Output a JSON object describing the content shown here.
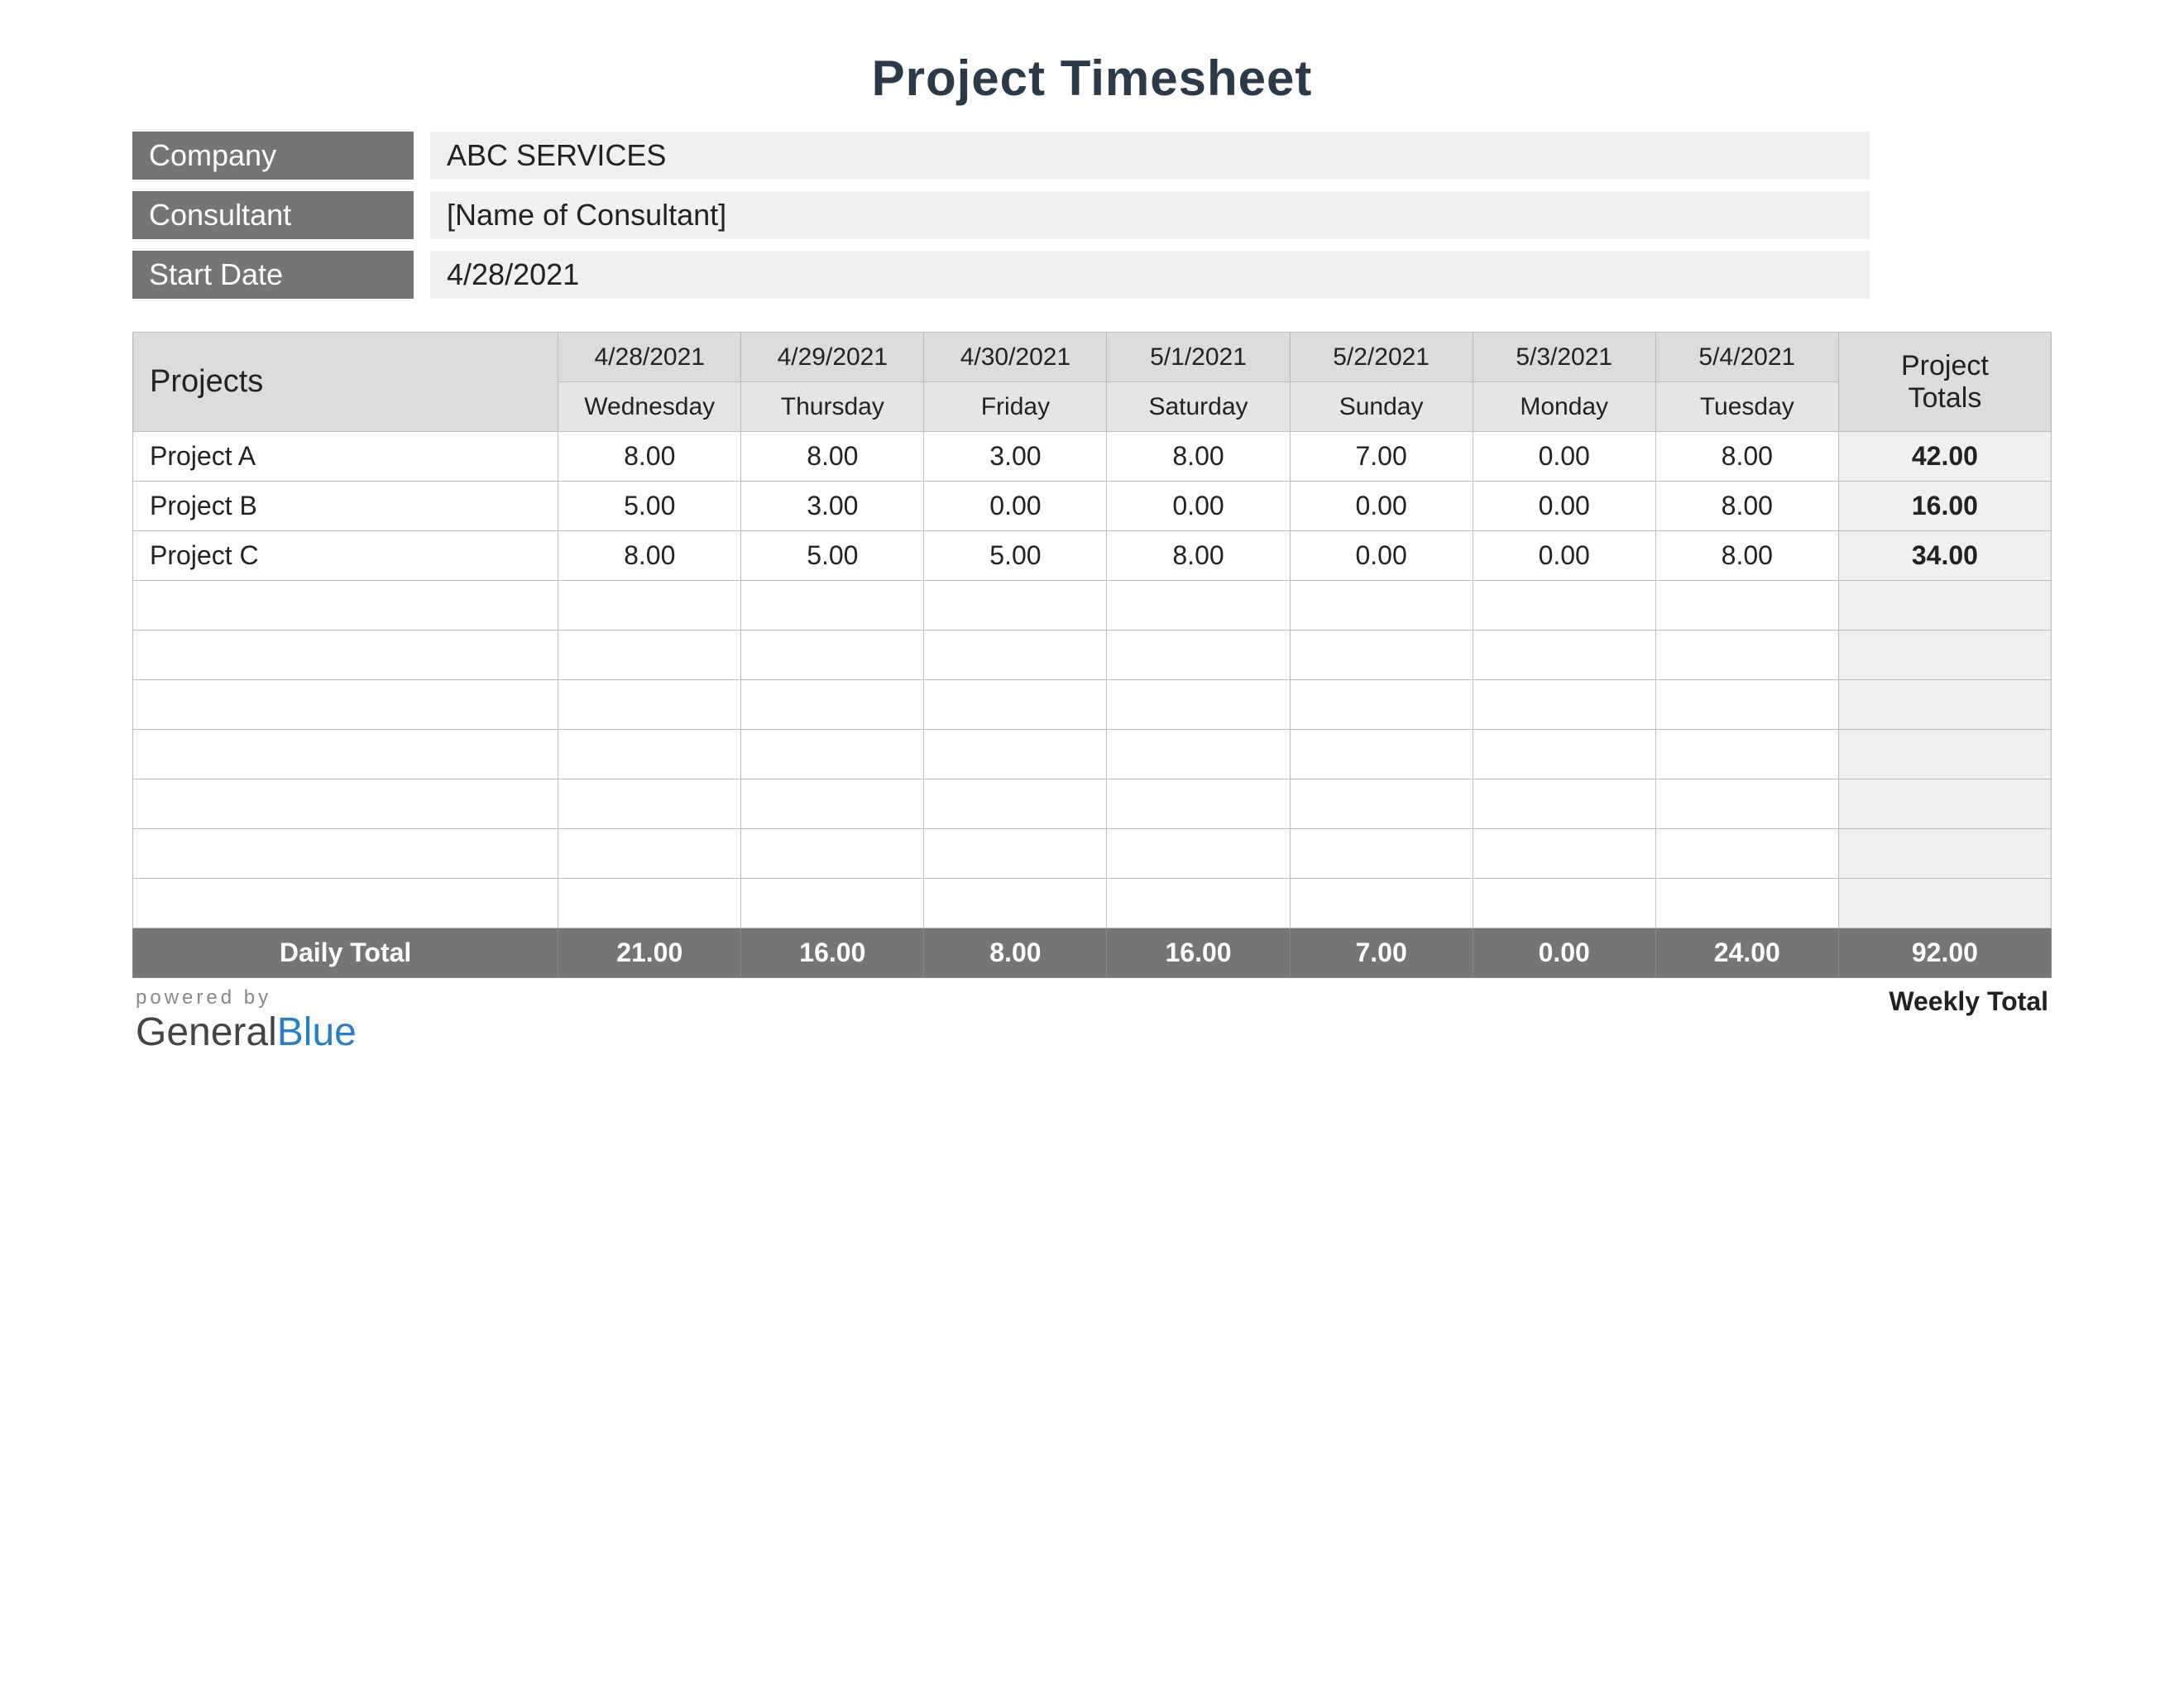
{
  "title": "Project Timesheet",
  "info": {
    "company_label": "Company",
    "company_value": "ABC SERVICES",
    "consultant_label": "Consultant",
    "consultant_value": "[Name of Consultant]",
    "startdate_label": "Start Date",
    "startdate_value": "4/28/2021"
  },
  "table": {
    "projects_header": "Projects",
    "totals_header_line1": "Project",
    "totals_header_line2": "Totals",
    "days": [
      {
        "date": "4/28/2021",
        "day": "Wednesday"
      },
      {
        "date": "4/29/2021",
        "day": "Thursday"
      },
      {
        "date": "4/30/2021",
        "day": "Friday"
      },
      {
        "date": "5/1/2021",
        "day": "Saturday"
      },
      {
        "date": "5/2/2021",
        "day": "Sunday"
      },
      {
        "date": "5/3/2021",
        "day": "Monday"
      },
      {
        "date": "5/4/2021",
        "day": "Tuesday"
      }
    ],
    "rows": [
      {
        "name": "Project A",
        "hours": [
          "8.00",
          "8.00",
          "3.00",
          "8.00",
          "7.00",
          "0.00",
          "8.00"
        ],
        "total": "42.00"
      },
      {
        "name": "Project B",
        "hours": [
          "5.00",
          "3.00",
          "0.00",
          "0.00",
          "0.00",
          "0.00",
          "8.00"
        ],
        "total": "16.00"
      },
      {
        "name": "Project C",
        "hours": [
          "8.00",
          "5.00",
          "5.00",
          "8.00",
          "0.00",
          "0.00",
          "8.00"
        ],
        "total": "34.00"
      }
    ],
    "empty_rows": 7,
    "daily_total_label": "Daily Total",
    "daily_totals": [
      "21.00",
      "16.00",
      "8.00",
      "16.00",
      "7.00",
      "0.00",
      "24.00"
    ],
    "grand_total": "92.00"
  },
  "footer": {
    "powered_by": "powered by",
    "brand_general": "General",
    "brand_blue": "Blue",
    "weekly_total_label": "Weekly Total"
  },
  "chart_data": {
    "type": "table",
    "title": "Project Timesheet",
    "columns": [
      "Project",
      "4/28/2021 Wednesday",
      "4/29/2021 Thursday",
      "4/30/2021 Friday",
      "5/1/2021 Saturday",
      "5/2/2021 Sunday",
      "5/3/2021 Monday",
      "5/4/2021 Tuesday",
      "Project Totals"
    ],
    "rows": [
      [
        "Project A",
        8.0,
        8.0,
        3.0,
        8.0,
        7.0,
        0.0,
        8.0,
        42.0
      ],
      [
        "Project B",
        5.0,
        3.0,
        0.0,
        0.0,
        0.0,
        0.0,
        8.0,
        16.0
      ],
      [
        "Project C",
        8.0,
        5.0,
        5.0,
        8.0,
        0.0,
        0.0,
        8.0,
        34.0
      ],
      [
        "Daily Total",
        21.0,
        16.0,
        8.0,
        16.0,
        7.0,
        0.0,
        24.0,
        92.0
      ]
    ]
  }
}
